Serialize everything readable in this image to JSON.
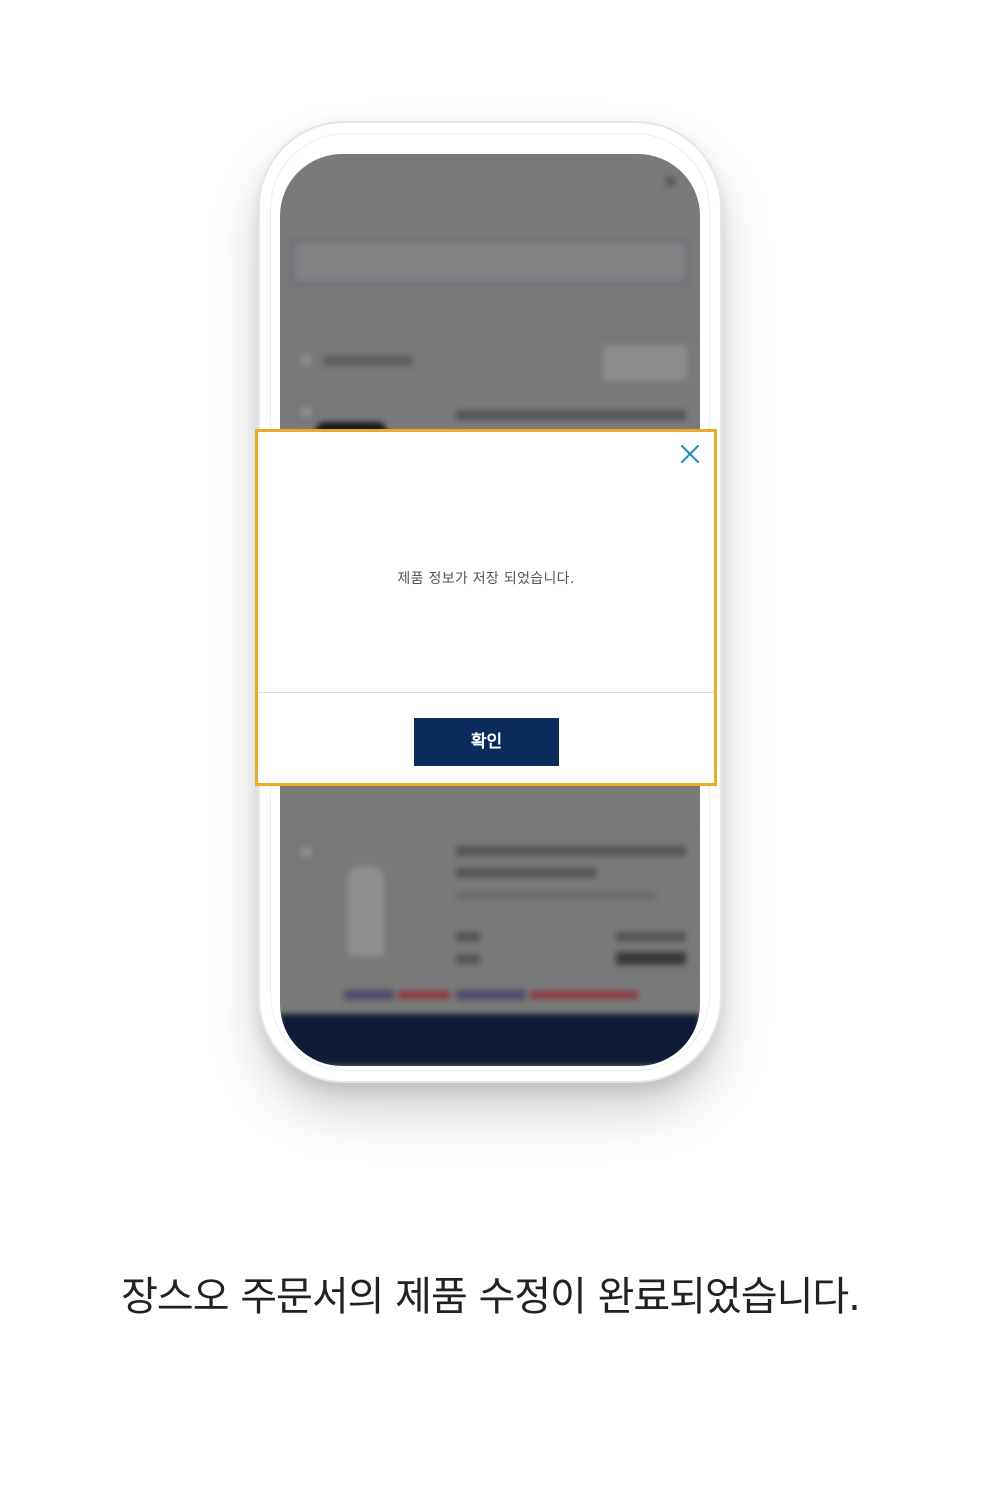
{
  "popup": {
    "message": "제품 정보가 저장 되었습니다.",
    "confirm_label": "확인",
    "close_icon": "close-icon",
    "border_color": "#e7ad28",
    "button_color": "#0a2b5c",
    "close_color": "#2b8fc2"
  },
  "caption": {
    "text": "장스오 주문서의 제품 수정이 완료되었습니다."
  }
}
